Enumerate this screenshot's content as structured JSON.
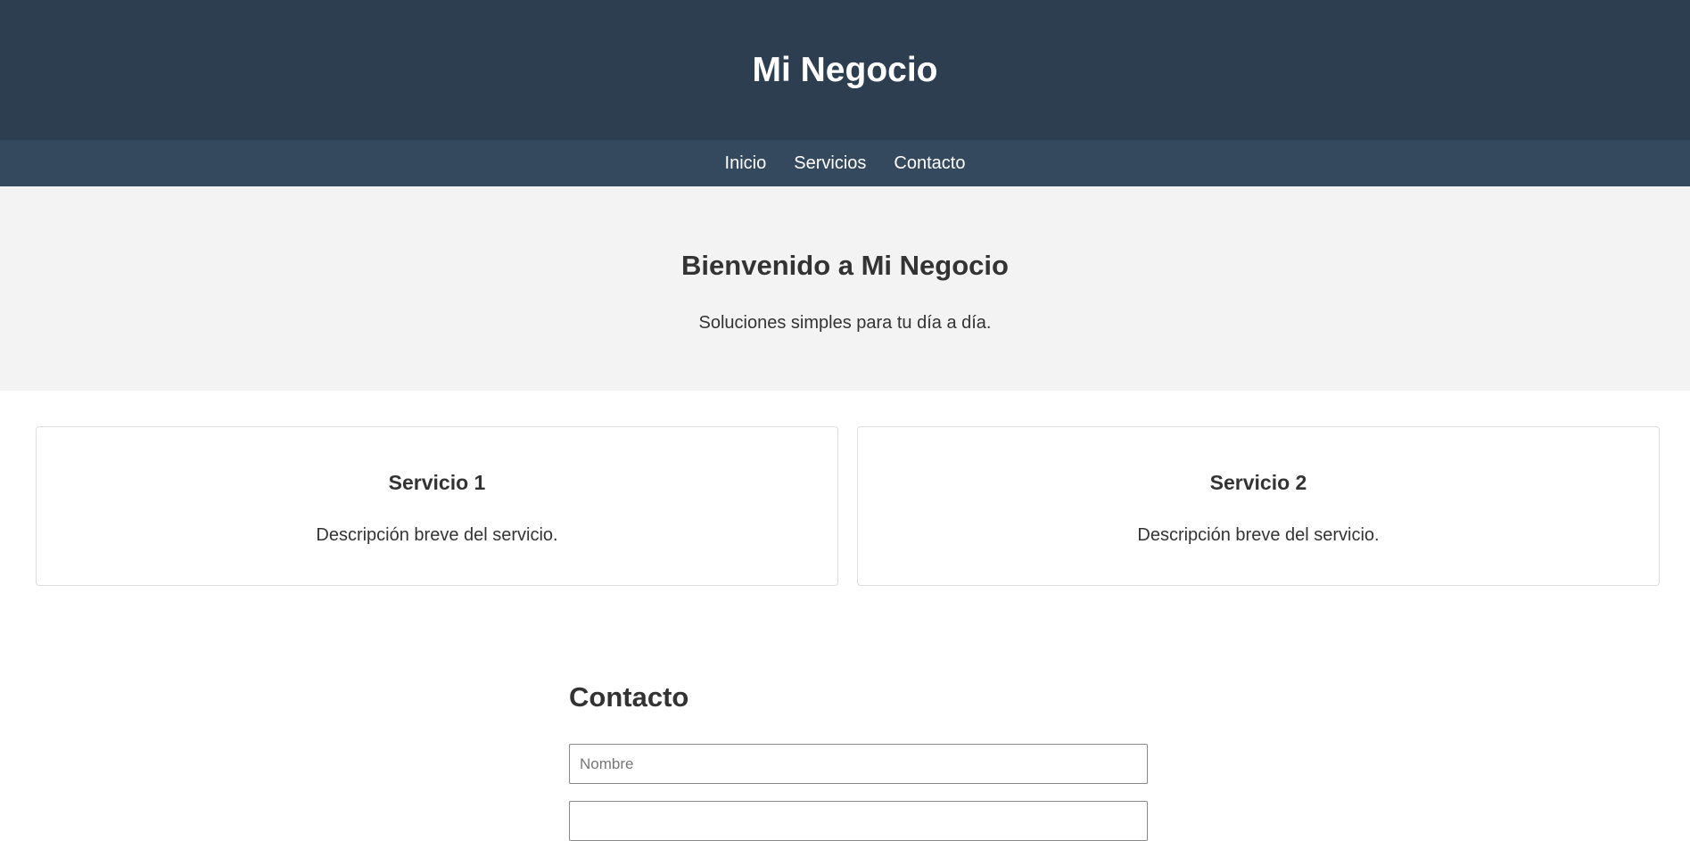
{
  "header": {
    "site_title": "Mi Negocio"
  },
  "nav": {
    "items": [
      {
        "label": "Inicio"
      },
      {
        "label": "Servicios"
      },
      {
        "label": "Contacto"
      }
    ]
  },
  "hero": {
    "title": "Bienvenido a Mi Negocio",
    "subtitle": "Soluciones simples para tu día a día."
  },
  "services": [
    {
      "title": "Servicio 1",
      "description": "Descripción breve del servicio."
    },
    {
      "title": "Servicio 2",
      "description": "Descripción breve del servicio."
    }
  ],
  "contact": {
    "title": "Contacto",
    "name_placeholder": "Nombre",
    "name_value": "",
    "second_field_placeholder": "",
    "second_field_value": ""
  },
  "colors": {
    "header_bg": "#2c3e50",
    "nav_bg": "#34495e",
    "hero_bg": "#f3f3f3",
    "text": "#333333"
  }
}
